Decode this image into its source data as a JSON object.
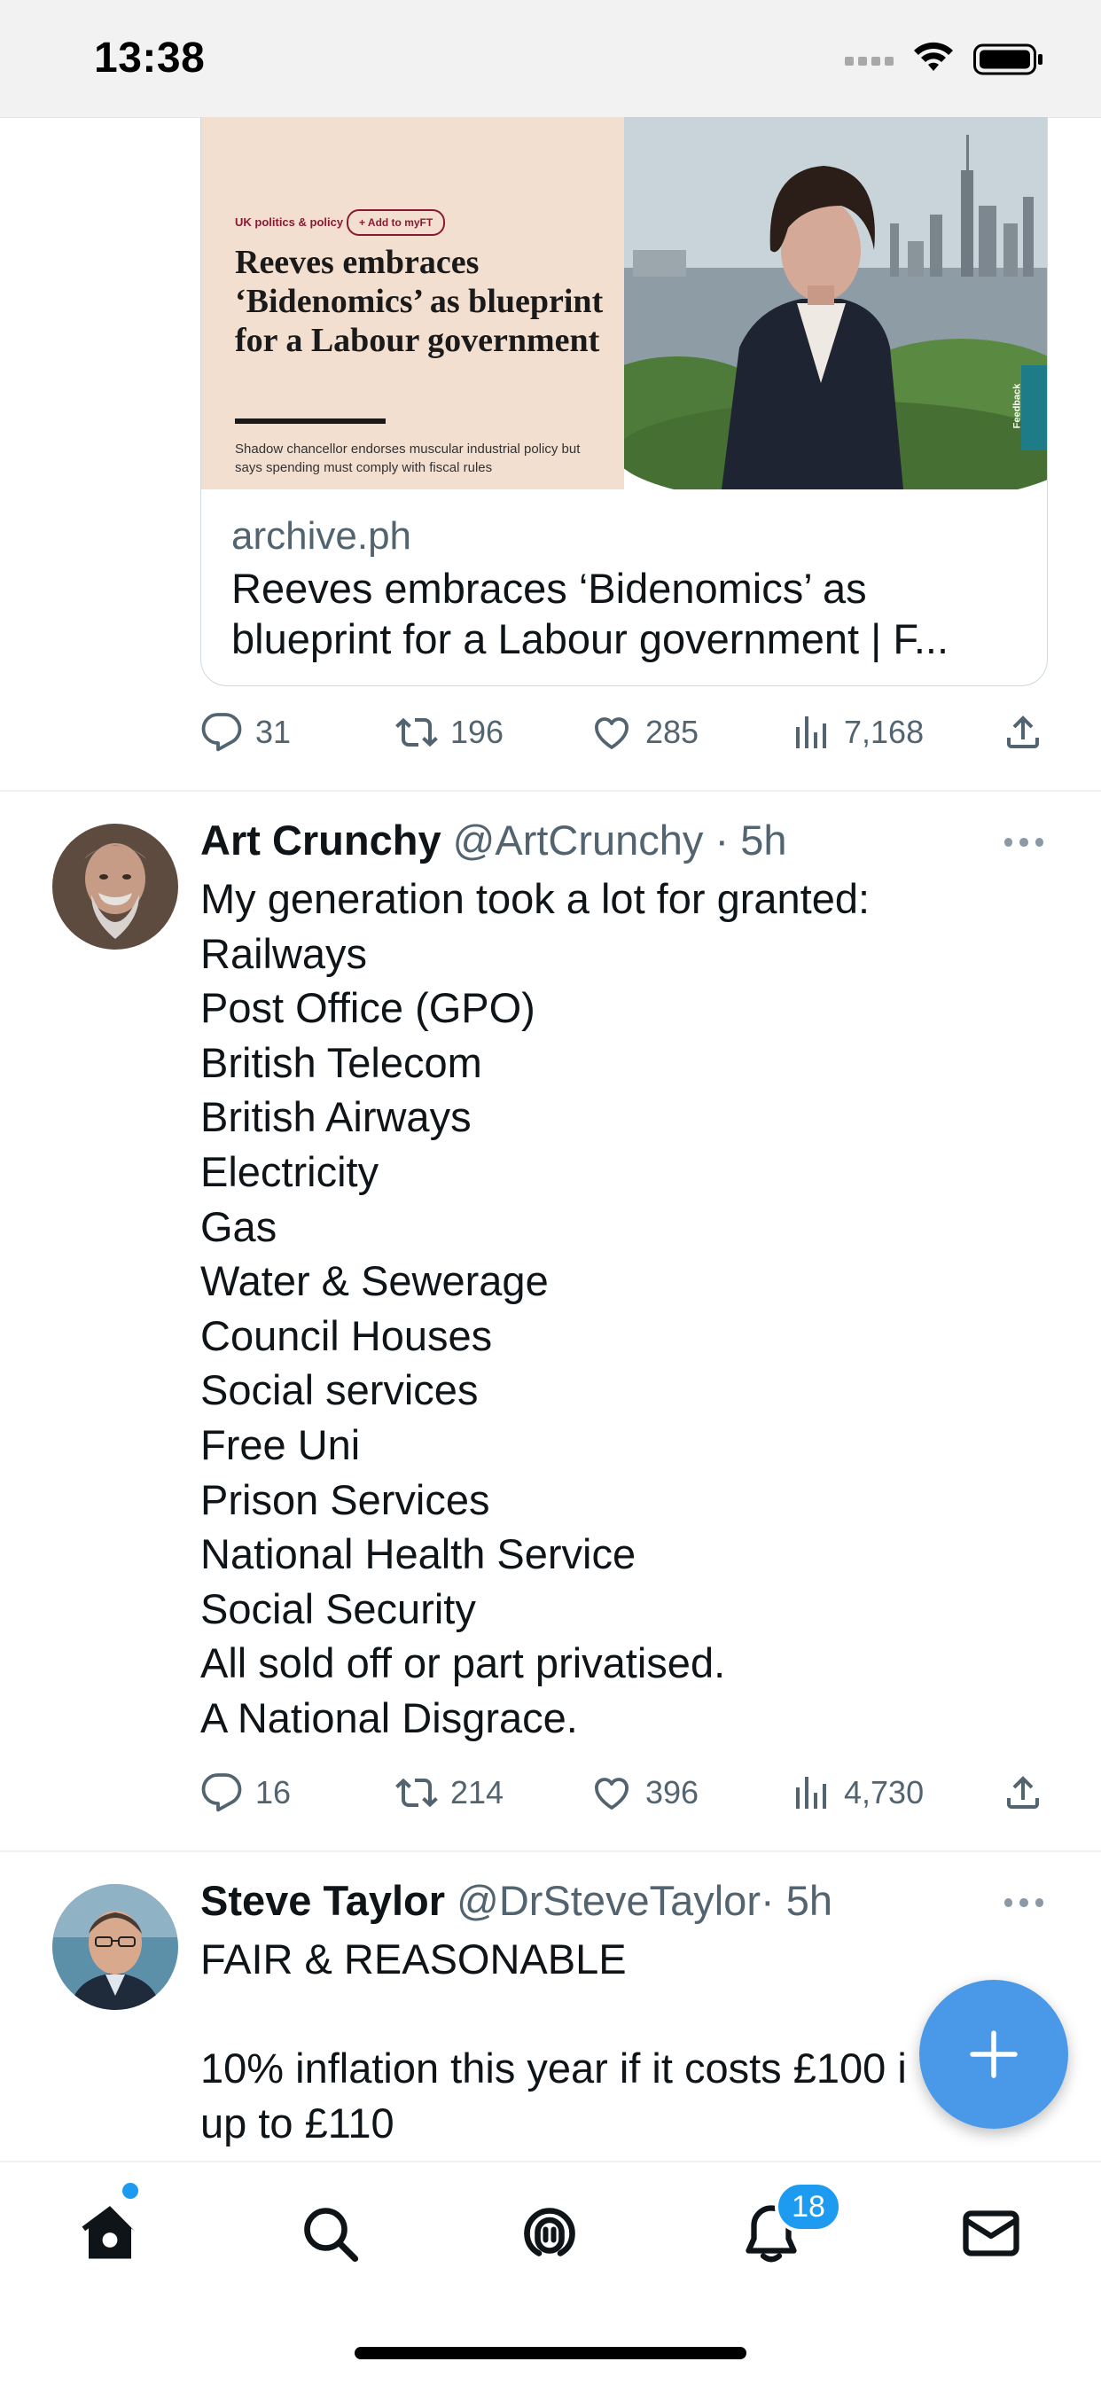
{
  "status_bar": {
    "time": "13:38"
  },
  "link_card": {
    "topic": "UK politics & policy",
    "myft_label": "+ Add to myFT",
    "headline": "Reeves embraces ‘Bidenomics’ as blueprint for a Labour government",
    "standfirst": "Shadow chancellor endorses muscular industrial policy but says spending must comply with fiscal rules",
    "feedback_label": "Feedback",
    "domain": "archive.ph",
    "title": "Reeves embraces ‘Bidenomics’ as blueprint for a Labour government | F..."
  },
  "tweet1_actions": {
    "replies": "31",
    "retweets": "196",
    "likes": "285",
    "views": "7,168"
  },
  "tweet2": {
    "name": "Art Crunchy",
    "handle": "@ArtCrunchy",
    "dot": "·",
    "time": "5h",
    "text": "My generation took a lot for granted:\nRailways\nPost Office (GPO)\nBritish Telecom\nBritish Airways\nElectricity\nGas\nWater & Sewerage\nCouncil Houses\nSocial services\nFree Uni\nPrison Services\nNational Health Service\nSocial Security\nAll sold off or part privatised.\nA National Disgrace.",
    "replies": "16",
    "retweets": "214",
    "likes": "396",
    "views": "4,730"
  },
  "tweet3": {
    "name": "Steve Taylor",
    "handle": "@DrSteveTaylor",
    "dot": "·",
    "time": "5h",
    "text": "FAIR & REASONABLE\n\n10% inflation this year if it costs £100 i\nup to £110"
  },
  "tab_bar": {
    "notifications_badge": "18",
    "icons": [
      "home-icon",
      "search-icon",
      "spaces-icon",
      "notifications-icon",
      "messages-icon"
    ]
  },
  "colors": {
    "accent": "#1d9bf0",
    "fab": "#4a99e9",
    "muted": "#536471"
  }
}
